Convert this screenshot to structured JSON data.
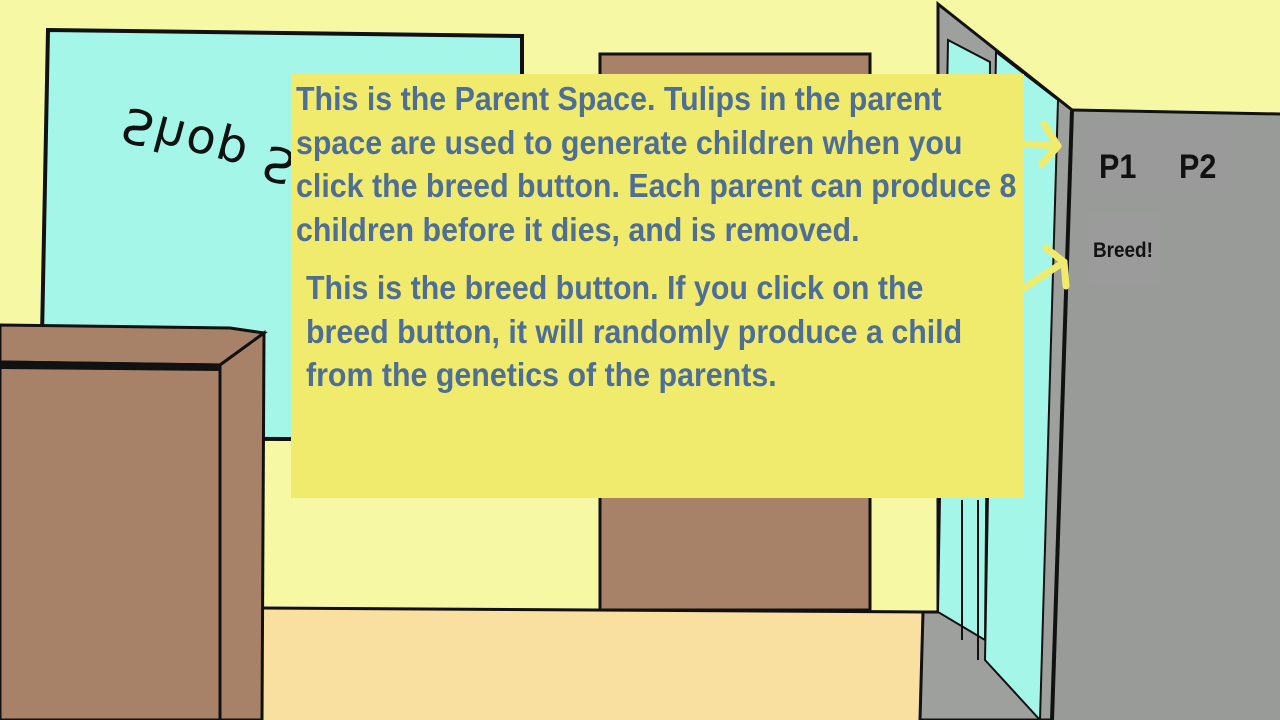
{
  "scene": {
    "shop_sign": "Shop S"
  },
  "tutorial": {
    "parent_space_text": "This is the Parent Space. Tulips in the parent space are used to generate children when you click the breed button. Each parent can produce 8 children before it dies, and is removed.",
    "breed_button_text": "This is the breed button. If you click on the breed button, it will randomly produce a child from the genetics of the parents."
  },
  "parents": {
    "slot1_label": "P1",
    "slot2_label": "P2"
  },
  "breed": {
    "label": "Breed!"
  },
  "colors": {
    "wall": "#f7f8a4",
    "floor": "#f9dfa0",
    "window": "#a4f7e8",
    "wood": "#a88268",
    "panel_bg": "#f0eb6c",
    "panel_text": "#4e6e96",
    "door_grey": "#999b98",
    "arrow": "#f0eb6c"
  }
}
